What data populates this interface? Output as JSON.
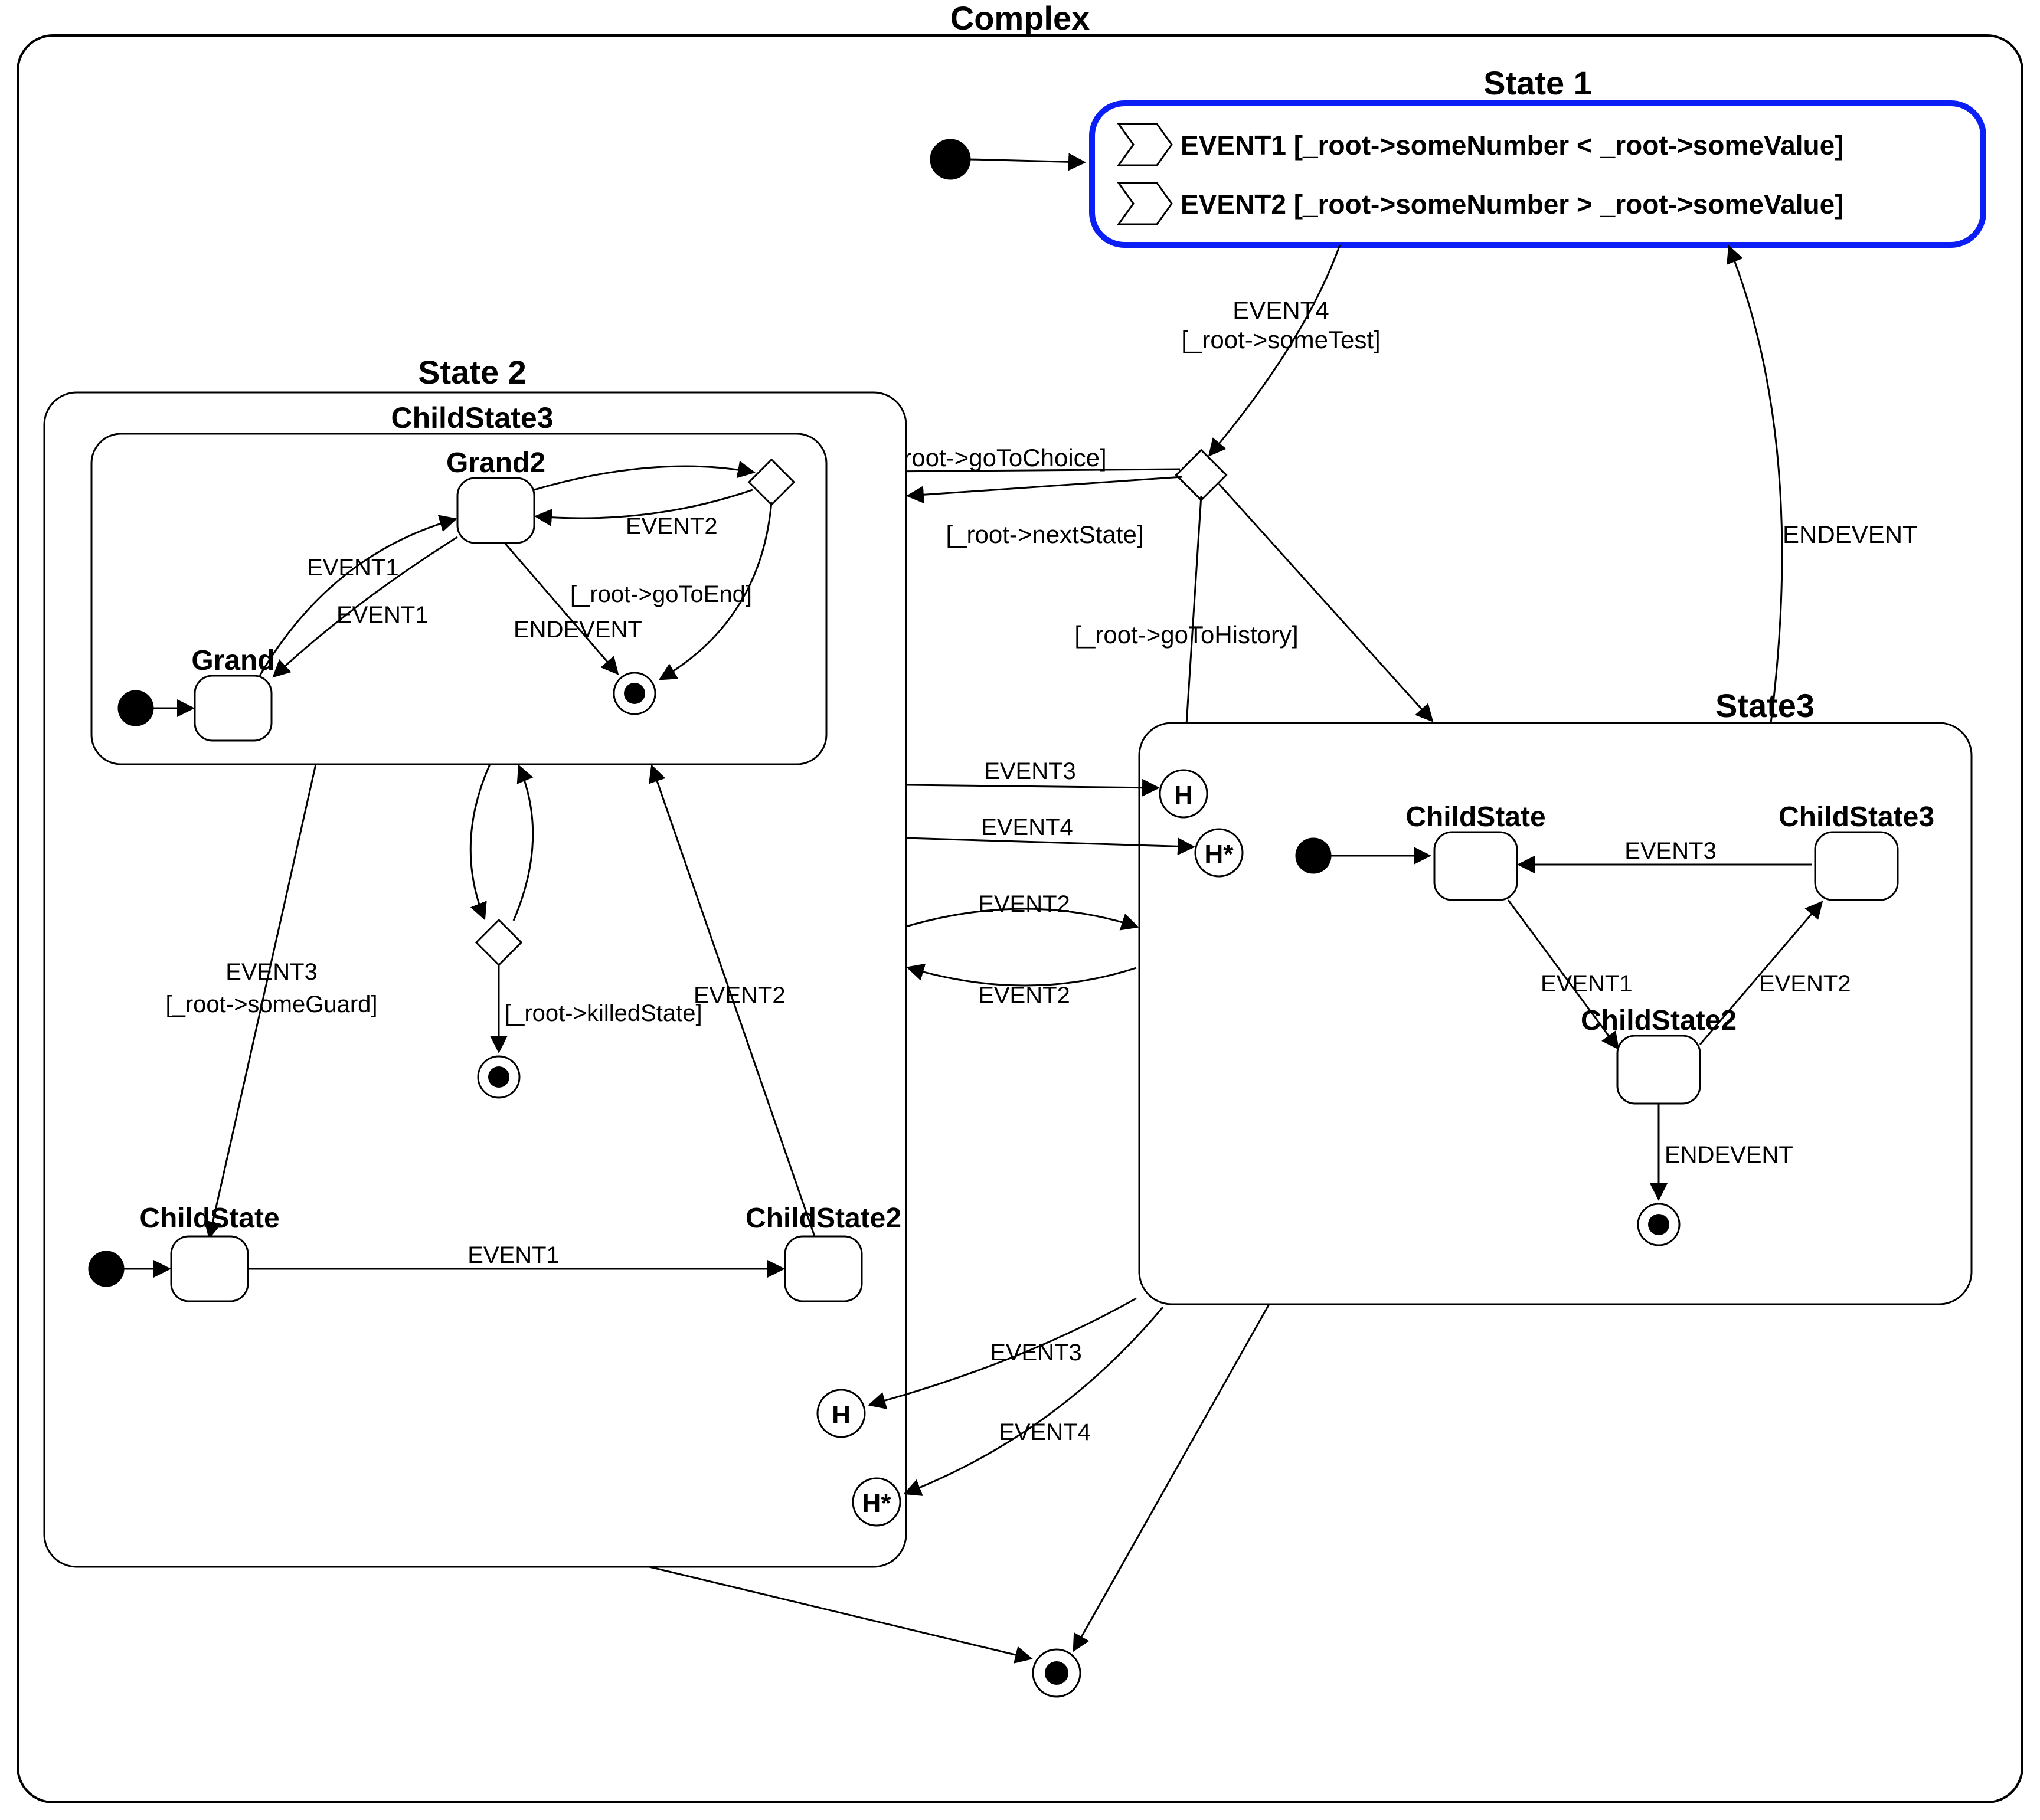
{
  "complex": {
    "title": "Complex",
    "state1": {
      "title": "State 1",
      "event1_label": "EVENT1 [_root->someNumber < _root->someValue]",
      "event2_label": "EVENT2 [_root->someNumber > _root->someValue]",
      "transition_out": {
        "event": "EVENT4",
        "guard": "[_root->someTest]"
      },
      "transition_in_endevent": "ENDEVENT"
    },
    "choice_main": {
      "branches": {
        "to_history": "[_root->goToHistory]",
        "to_state2_top": "[_root->nextState]",
        "to_childstate3_choice": "[_root->goToChoice]"
      }
    },
    "state2": {
      "title": "State 2",
      "childstate3": {
        "title": "ChildState3",
        "grand": "Grand",
        "grand2": "Grand2",
        "transitions": {
          "grand_to_grand2_1": "EVENT1",
          "grand_to_grand2_2": "EVENT1",
          "grand2_to_choice": "EVENT2",
          "grand2_choice_guard": "[_root->goToEnd]",
          "grand2_to_final": "ENDEVENT"
        }
      },
      "childstate": "ChildState",
      "childstate2": "ChildState2",
      "transitions": {
        "childstate_to_childstate2": "EVENT1",
        "childstate2_to_childstate3": "EVENT2",
        "childstate3_to_childstate": {
          "event": "EVENT3",
          "guard": "[_root->someGuard]"
        },
        "choice_killed_guard": "[_root->killedState]"
      },
      "history_shallow": "H",
      "history_deep": "H*"
    },
    "state3": {
      "title": "State3",
      "childstate": "ChildState",
      "childstate2": "ChildState2",
      "childstate3": "ChildState3",
      "history_shallow": "H",
      "history_deep": "H*",
      "transitions": {
        "cs_to_cs2": "EVENT1",
        "cs2_to_cs3": "EVENT2",
        "cs3_to_cs": "EVENT3",
        "cs2_to_final": "ENDEVENT"
      }
    },
    "cross_transitions": {
      "s2_to_s3_h": "EVENT3",
      "s2_to_s3_hstar": "EVENT4",
      "s2_s3_a": "EVENT2",
      "s2_s3_b": "EVENT2",
      "s3_to_s2_h": "EVENT3",
      "s3_to_s2_hstar": "EVENT4"
    }
  }
}
